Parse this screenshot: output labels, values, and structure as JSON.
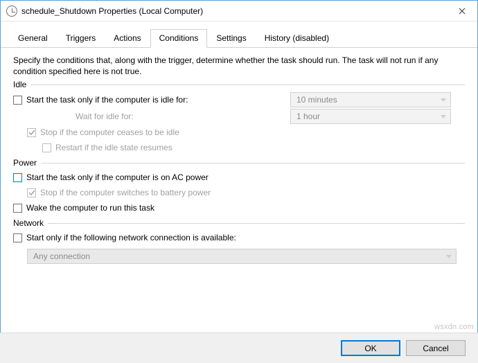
{
  "window": {
    "title": "schedule_Shutdown Properties (Local Computer)"
  },
  "tabs": {
    "items": [
      {
        "label": "General"
      },
      {
        "label": "Triggers"
      },
      {
        "label": "Actions"
      },
      {
        "label": "Conditions"
      },
      {
        "label": "Settings"
      },
      {
        "label": "History (disabled)"
      }
    ],
    "active_index": 3
  },
  "conditions": {
    "description": "Specify the conditions that, along with the trigger, determine whether the task should run.  The task will not run  if any condition specified here is not true.",
    "idle": {
      "header": "Idle",
      "start_only_idle_label": "Start the task only if the computer is idle for:",
      "start_only_idle_checked": false,
      "idle_duration": "10 minutes",
      "wait_label": "Wait for idle for:",
      "wait_duration": "1 hour",
      "stop_if_not_idle_label": "Stop if the computer ceases to be idle",
      "stop_if_not_idle_checked": true,
      "restart_if_idle_label": "Restart if the idle state resumes",
      "restart_if_idle_checked": false
    },
    "power": {
      "header": "Power",
      "ac_power_label": "Start the task only if the computer is on AC power",
      "ac_power_checked": false,
      "stop_battery_label": "Stop if the computer switches to battery power",
      "stop_battery_checked": true,
      "wake_label": "Wake the computer to run this task",
      "wake_checked": false
    },
    "network": {
      "header": "Network",
      "start_only_net_label": "Start only if the following network connection is available:",
      "start_only_net_checked": false,
      "connection": "Any connection"
    }
  },
  "footer": {
    "ok": "OK",
    "cancel": "Cancel"
  },
  "watermark": "wsxdn.com"
}
